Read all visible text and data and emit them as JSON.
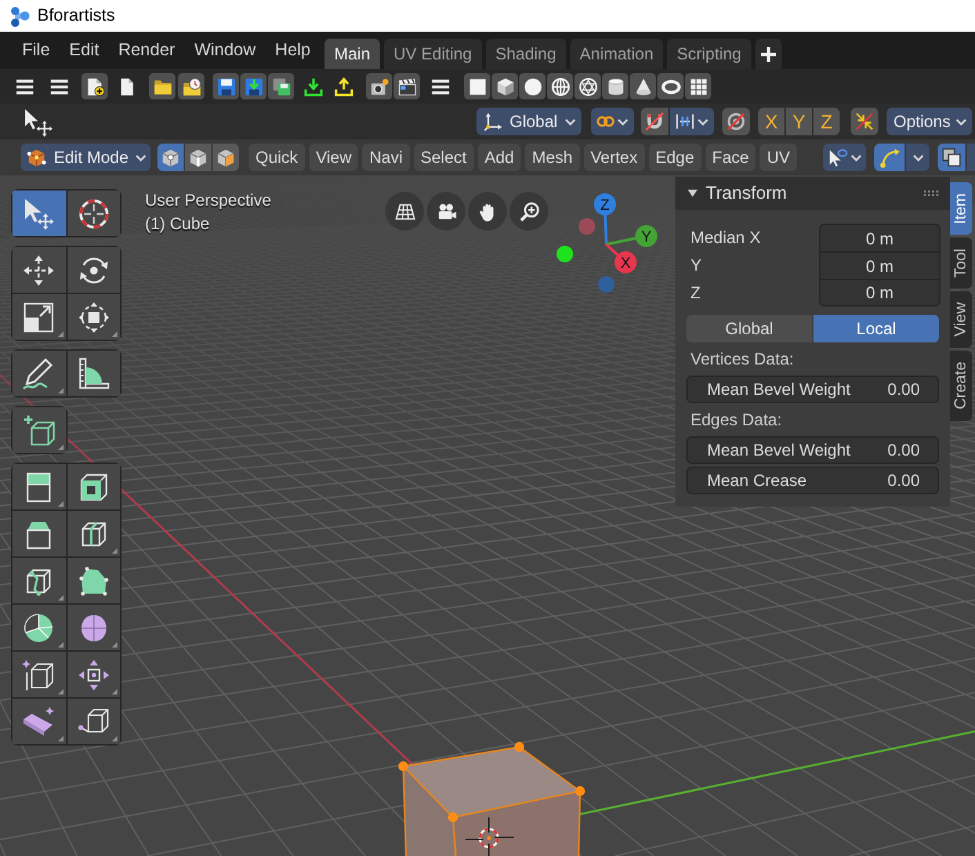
{
  "window": {
    "title": "Bforartists"
  },
  "menu": [
    "File",
    "Edit",
    "Render",
    "Window",
    "Help"
  ],
  "workspaces": [
    {
      "label": "Main",
      "selected": true
    },
    {
      "label": "UV Editing",
      "selected": false
    },
    {
      "label": "Shading",
      "selected": false
    },
    {
      "label": "Animation",
      "selected": false
    },
    {
      "label": "Scripting",
      "selected": false
    }
  ],
  "tool_header": {
    "orientation": "Global",
    "snap": {
      "on": false
    },
    "proportional": {
      "on": false
    },
    "mirror": [
      {
        "label": "X",
        "on": false
      },
      {
        "label": "Y",
        "on": false
      },
      {
        "label": "Z",
        "on": false
      }
    ],
    "auto_merge": {
      "on": false
    },
    "options": "Options"
  },
  "edit_header": {
    "mode": "Edit Mode",
    "select_modes": [
      {
        "kind": "vertex",
        "selected": true
      },
      {
        "kind": "edge",
        "selected": false
      },
      {
        "kind": "face",
        "selected": false
      }
    ],
    "menus": [
      "Quick",
      "View",
      "Navi",
      "Select",
      "Add",
      "Mesh",
      "Vertex",
      "Edge",
      "Face",
      "UV"
    ],
    "gizmo_toggle": {
      "on": true
    },
    "overlay_toggle": {
      "on": true
    }
  },
  "toolbar": [
    [
      {
        "kind": "select_box",
        "selected": true,
        "more_tools": false
      },
      {
        "kind": "cursor",
        "selected": false,
        "more_tools": false
      }
    ],
    [
      {
        "kind": "move",
        "selected": false,
        "more_tools": false
      },
      {
        "kind": "rotate",
        "selected": false,
        "more_tools": false
      },
      {
        "kind": "scale",
        "selected": false,
        "more_tools": true
      },
      {
        "kind": "transform",
        "selected": false,
        "more_tools": true
      }
    ],
    [
      {
        "kind": "annotate",
        "selected": false,
        "more_tools": true
      },
      {
        "kind": "measure",
        "selected": false,
        "more_tools": false
      }
    ],
    [
      {
        "kind": "add_cube",
        "selected": false,
        "more_tools": true
      }
    ],
    [
      {
        "kind": "extrude",
        "selected": false,
        "more_tools": true
      },
      {
        "kind": "inset",
        "selected": false,
        "more_tools": false
      },
      {
        "kind": "bevel",
        "selected": false,
        "more_tools": false
      },
      {
        "kind": "loop_cut",
        "selected": false,
        "more_tools": true
      },
      {
        "kind": "knife",
        "selected": false,
        "more_tools": true
      },
      {
        "kind": "poly_build",
        "selected": false,
        "more_tools": false
      },
      {
        "kind": "spin",
        "selected": false,
        "more_tools": true
      },
      {
        "kind": "smooth",
        "selected": false,
        "more_tools": true
      },
      {
        "kind": "edge_slide",
        "selected": false,
        "more_tools": true
      },
      {
        "kind": "shrink_fatten",
        "selected": false,
        "more_tools": true
      },
      {
        "kind": "shear",
        "selected": false,
        "more_tools": true
      },
      {
        "kind": "rip",
        "selected": false,
        "more_tools": true
      }
    ]
  ],
  "viewport": {
    "view_name": "User Perspective",
    "object_name": "(1) Cube"
  },
  "axis_gizmo": {
    "axes": [
      {
        "label": "Z",
        "color": "#2f7fe0"
      },
      {
        "label": "Y",
        "color": "#44a335"
      },
      {
        "label": "X",
        "color": "#e8364f"
      }
    ],
    "negative_axes": [
      {
        "color": "#30609c"
      },
      {
        "color": "#1fe21f"
      },
      {
        "color": "#9c4a58"
      }
    ]
  },
  "sidebar": {
    "panel_title": "Transform",
    "median": [
      {
        "label": "Median X",
        "value": "0 m"
      },
      {
        "label": "Y",
        "value": "0 m"
      },
      {
        "label": "Z",
        "value": "0 m"
      }
    ],
    "space": [
      {
        "label": "Global",
        "selected": false
      },
      {
        "label": "Local",
        "selected": true
      }
    ],
    "sections": [
      {
        "heading": "Vertices Data:",
        "rows": [
          {
            "label": "Mean Bevel Weight",
            "value": "0.00"
          }
        ]
      },
      {
        "heading": "Edges Data:",
        "rows": [
          {
            "label": "Mean Bevel Weight",
            "value": "0.00"
          },
          {
            "label": "Mean Crease",
            "value": "0.00"
          }
        ]
      }
    ],
    "tabs": [
      {
        "label": "Item",
        "selected": true
      },
      {
        "label": "Tool",
        "selected": false
      },
      {
        "label": "View",
        "selected": false
      },
      {
        "label": "Create",
        "selected": false
      }
    ]
  }
}
